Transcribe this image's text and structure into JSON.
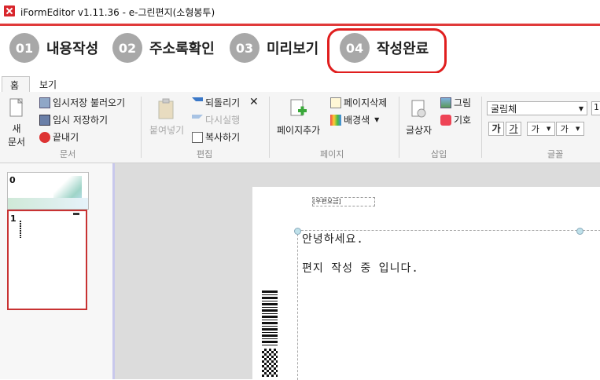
{
  "window": {
    "title": "iFormEditor v1.11.36 - e-그린편지(소형봉투)"
  },
  "steps": [
    {
      "num": "01",
      "label": "내용작성"
    },
    {
      "num": "02",
      "label": "주소록확인"
    },
    {
      "num": "03",
      "label": "미리보기"
    },
    {
      "num": "04",
      "label": "작성완료"
    }
  ],
  "tabs": {
    "home": "홈",
    "view": "보기"
  },
  "ribbon": {
    "doc": {
      "new_line1": "새",
      "new_line2": "문서",
      "load_temp": "임시저장 불러오기",
      "save_temp": "임시 저장하기",
      "close": "끝내기",
      "group": "문서"
    },
    "edit": {
      "paste": "붙여넣기",
      "undo": "되돌리기",
      "redo": "다시실행",
      "copy": "복사하기",
      "group": "편집"
    },
    "page": {
      "add": "페이지추가",
      "delete": "페이지삭제",
      "bgcolor": "배경색",
      "group": "페이지"
    },
    "insert": {
      "textbox": "글상자",
      "image": "그림",
      "symbol": "기호",
      "group": "삽입"
    },
    "font": {
      "name": "굴림체",
      "size": "1",
      "bold": "가",
      "underline": "가",
      "color": "가",
      "highlight": "가",
      "group": "글꼴"
    }
  },
  "thumbnails": [
    {
      "num": "0"
    },
    {
      "num": "1"
    }
  ],
  "document": {
    "stamp": "[우편요금]",
    "line1": "안녕하세요.",
    "line2": "편지 작성 중 입니다."
  },
  "colors": {
    "accent_red": "#e03a3a",
    "step_circle": "#a8a8a8",
    "highlight_border": "#e01e1e"
  }
}
